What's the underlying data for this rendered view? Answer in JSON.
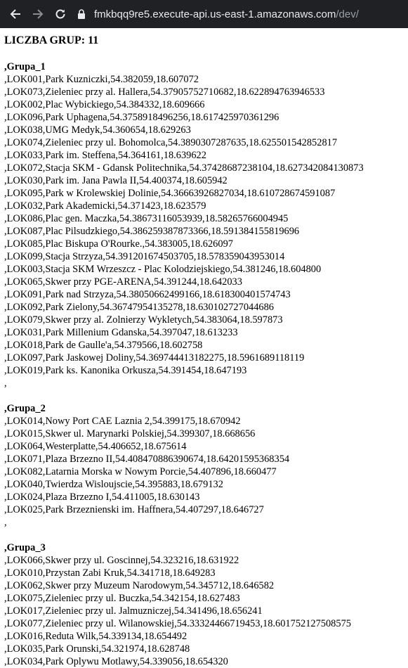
{
  "browser": {
    "url_host": "fmkbqq9re5.execute-api.us-east-1.amazonaws.com",
    "url_path": "/dev/"
  },
  "page": {
    "count_line": "LICZBA GRUP: 11",
    "groups": [
      {
        "title": ",Grupa_1",
        "lines": [
          ",LOK001,Park Kuzniczki,54.382059,18.607072",
          ",LOK073,Zieleniec przy al. Hallera,54.37905752710682,18.622894763946533",
          ",LOK002,Plac Wybickiego,54.384332,18.609666",
          ",LOK096,Park Uphagena,54.3758918496256,18.617425970361296",
          ",LOK038,UMG Medyk,54.360654,18.629263",
          ",LOK074,Zieleniec przy ul. Bohomolca,54.3890307287635,18.625501542852817",
          ",LOK033,Park im. Steffena,54.364161,18.639622",
          ",LOK072,Stacja SKM - Gdansk Politechnika,54.37428687238104,18.627342084130873",
          ",LOK030,Park im. Jana Pawla II,54.400374,18.605942",
          ",LOK095,Park w Krolewskiej Dolinie,54.36663926827034,18.610728674591087",
          ",LOK032,Park Akademicki,54.371423,18.623579",
          ",LOK086,Plac gen. Maczka,54.38673116053939,18.58265766004945",
          ",LOK087,Plac Pilsudzkiego,54.386259387873366,18.591384155819696",
          ",LOK085,Plac Biskupa O'Rourke.,54.383005,18.626097",
          ",LOK099,Stacja Strzyza,54.391201674503705,18.578359043953014",
          ",LOK003,Stacja SKM Wrzeszcz - Plac Kolodziejskiego,54.381246,18.604800",
          ",LOK065,Skwer przy PGE-ARENA,54.391244,18.642033",
          ",LOK091,Park nad Strzyza,54.38050662499166,18.618300401574743",
          ",LOK092,Park Zielony,54.36747954135278,18.630102727044686",
          ",LOK079,Skwer przy al. Zolnierzy Wykletych,54.383064,18.597873",
          ",LOK031,Park Millenium Gdanska,54.397047,18.613233",
          ",LOK018,Park de Gaulle'a,54.379566,18.602758",
          ",LOK097,Park Jaskowej Doliny,54.369744413182275,18.5961689118119",
          ",LOK019,Park ks. Kanonika Orkusza,54.391454,18.647193"
        ],
        "end": ","
      },
      {
        "title": ",Grupa_2",
        "lines": [
          ",LOK014,Nowy Port CAE Laznia 2,54.399175,18.670942",
          ",LOK015,Skwer ul. Marynarki Polskiej,54.399307,18.668656",
          ",LOK064,Westerplatte,54.406652,18.675614",
          ",LOK071,Plaza Brzezno II,54.408470886390674,18.64201595368354",
          ",LOK082,Latarnia Morska w Nowym Porcie,54.407896,18.660477",
          ",LOK040,Twierdza Wisloujscie,54.395883,18.679132",
          ",LOK024,Plaza Brzezno I,54.411005,18.630143",
          ",LOK025,Park Brzeznienski im. Haffnera,54.407297,18.646727"
        ],
        "end": ","
      },
      {
        "title": ",Grupa_3",
        "lines": [
          ",LOK066,Skwer przy ul. Goscinnej,54.323216,18.631922",
          ",LOK010,Przystan Zabi Kruk,54.341718,18.649283",
          ",LOK062,Skwer przy Muzeum Narodowym,54.345712,18.646582",
          ",LOK075,Zieleniec przy ul. Buczka,54.342154,18.627483",
          ",LOK017,Zieleniec przy ul. Jalmuzniczej,54.341496,18.656241",
          ",LOK077,Zieleniec przy ul. Wilanowskiej,54.33324466719453,18.601752127508575",
          ",LOK016,Reduta Wilk,54.339134,18.654492",
          ",LOK035,Park Orunski,54.321974,18.628748",
          ",LOK034,Park Oplywu Motlawy,54.339056,18.654320"
        ],
        "end": ""
      }
    ]
  }
}
